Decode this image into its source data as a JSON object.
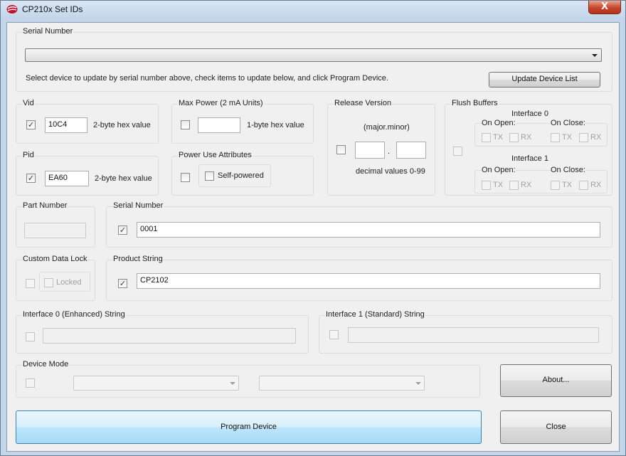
{
  "window": {
    "title": "CP210x Set IDs",
    "close_glyph": "X"
  },
  "serial_select": {
    "group_label": "Serial Number",
    "instructions": "Select device to update by serial number above, check items to update below, and click Program Device.",
    "update_button": "Update Device List"
  },
  "vid": {
    "label": "Vid",
    "value": "10C4",
    "hint": "2-byte hex value",
    "checked": true
  },
  "pid": {
    "label": "Pid",
    "value": "EA60",
    "hint": "2-byte hex value",
    "checked": true
  },
  "max_power": {
    "label": "Max Power (2 mA Units)",
    "value": "",
    "hint": "1-byte hex value"
  },
  "power_use": {
    "label": "Power Use Attributes",
    "self_powered": "Self-powered"
  },
  "release_version": {
    "label": "Release Version",
    "format": "(major.minor)",
    "separator": ".",
    "hint": "decimal values 0-99"
  },
  "flush_buffers": {
    "label": "Flush Buffers",
    "interface0": {
      "label": "Interface 0",
      "on_open": "On Open:",
      "on_close": "On Close:",
      "tx": "TX",
      "rx": "RX"
    },
    "interface1": {
      "label": "Interface 1",
      "on_open": "On Open:",
      "on_close": "On Close:",
      "tx": "TX",
      "rx": "RX"
    }
  },
  "part_number": {
    "label": "Part Number",
    "value": ""
  },
  "serial_number": {
    "label": "Serial Number",
    "value": "0001",
    "checked": true
  },
  "custom_data_lock": {
    "label": "Custom Data Lock",
    "locked": "Locked"
  },
  "product_string": {
    "label": "Product String",
    "value": "CP2102",
    "checked": true
  },
  "interface0_string": {
    "label": "Interface 0 (Enhanced) String",
    "value": ""
  },
  "interface1_string": {
    "label": "Interface 1 (Standard) String",
    "value": ""
  },
  "device_mode": {
    "label": "Device Mode"
  },
  "buttons": {
    "about": "About...",
    "program": "Program Device",
    "close": "Close"
  },
  "check_glyph": "✓",
  "colors": {
    "primary_button": "#a7d9f5",
    "close_button": "#c8442b",
    "title_bar": "#c4d6ea"
  }
}
